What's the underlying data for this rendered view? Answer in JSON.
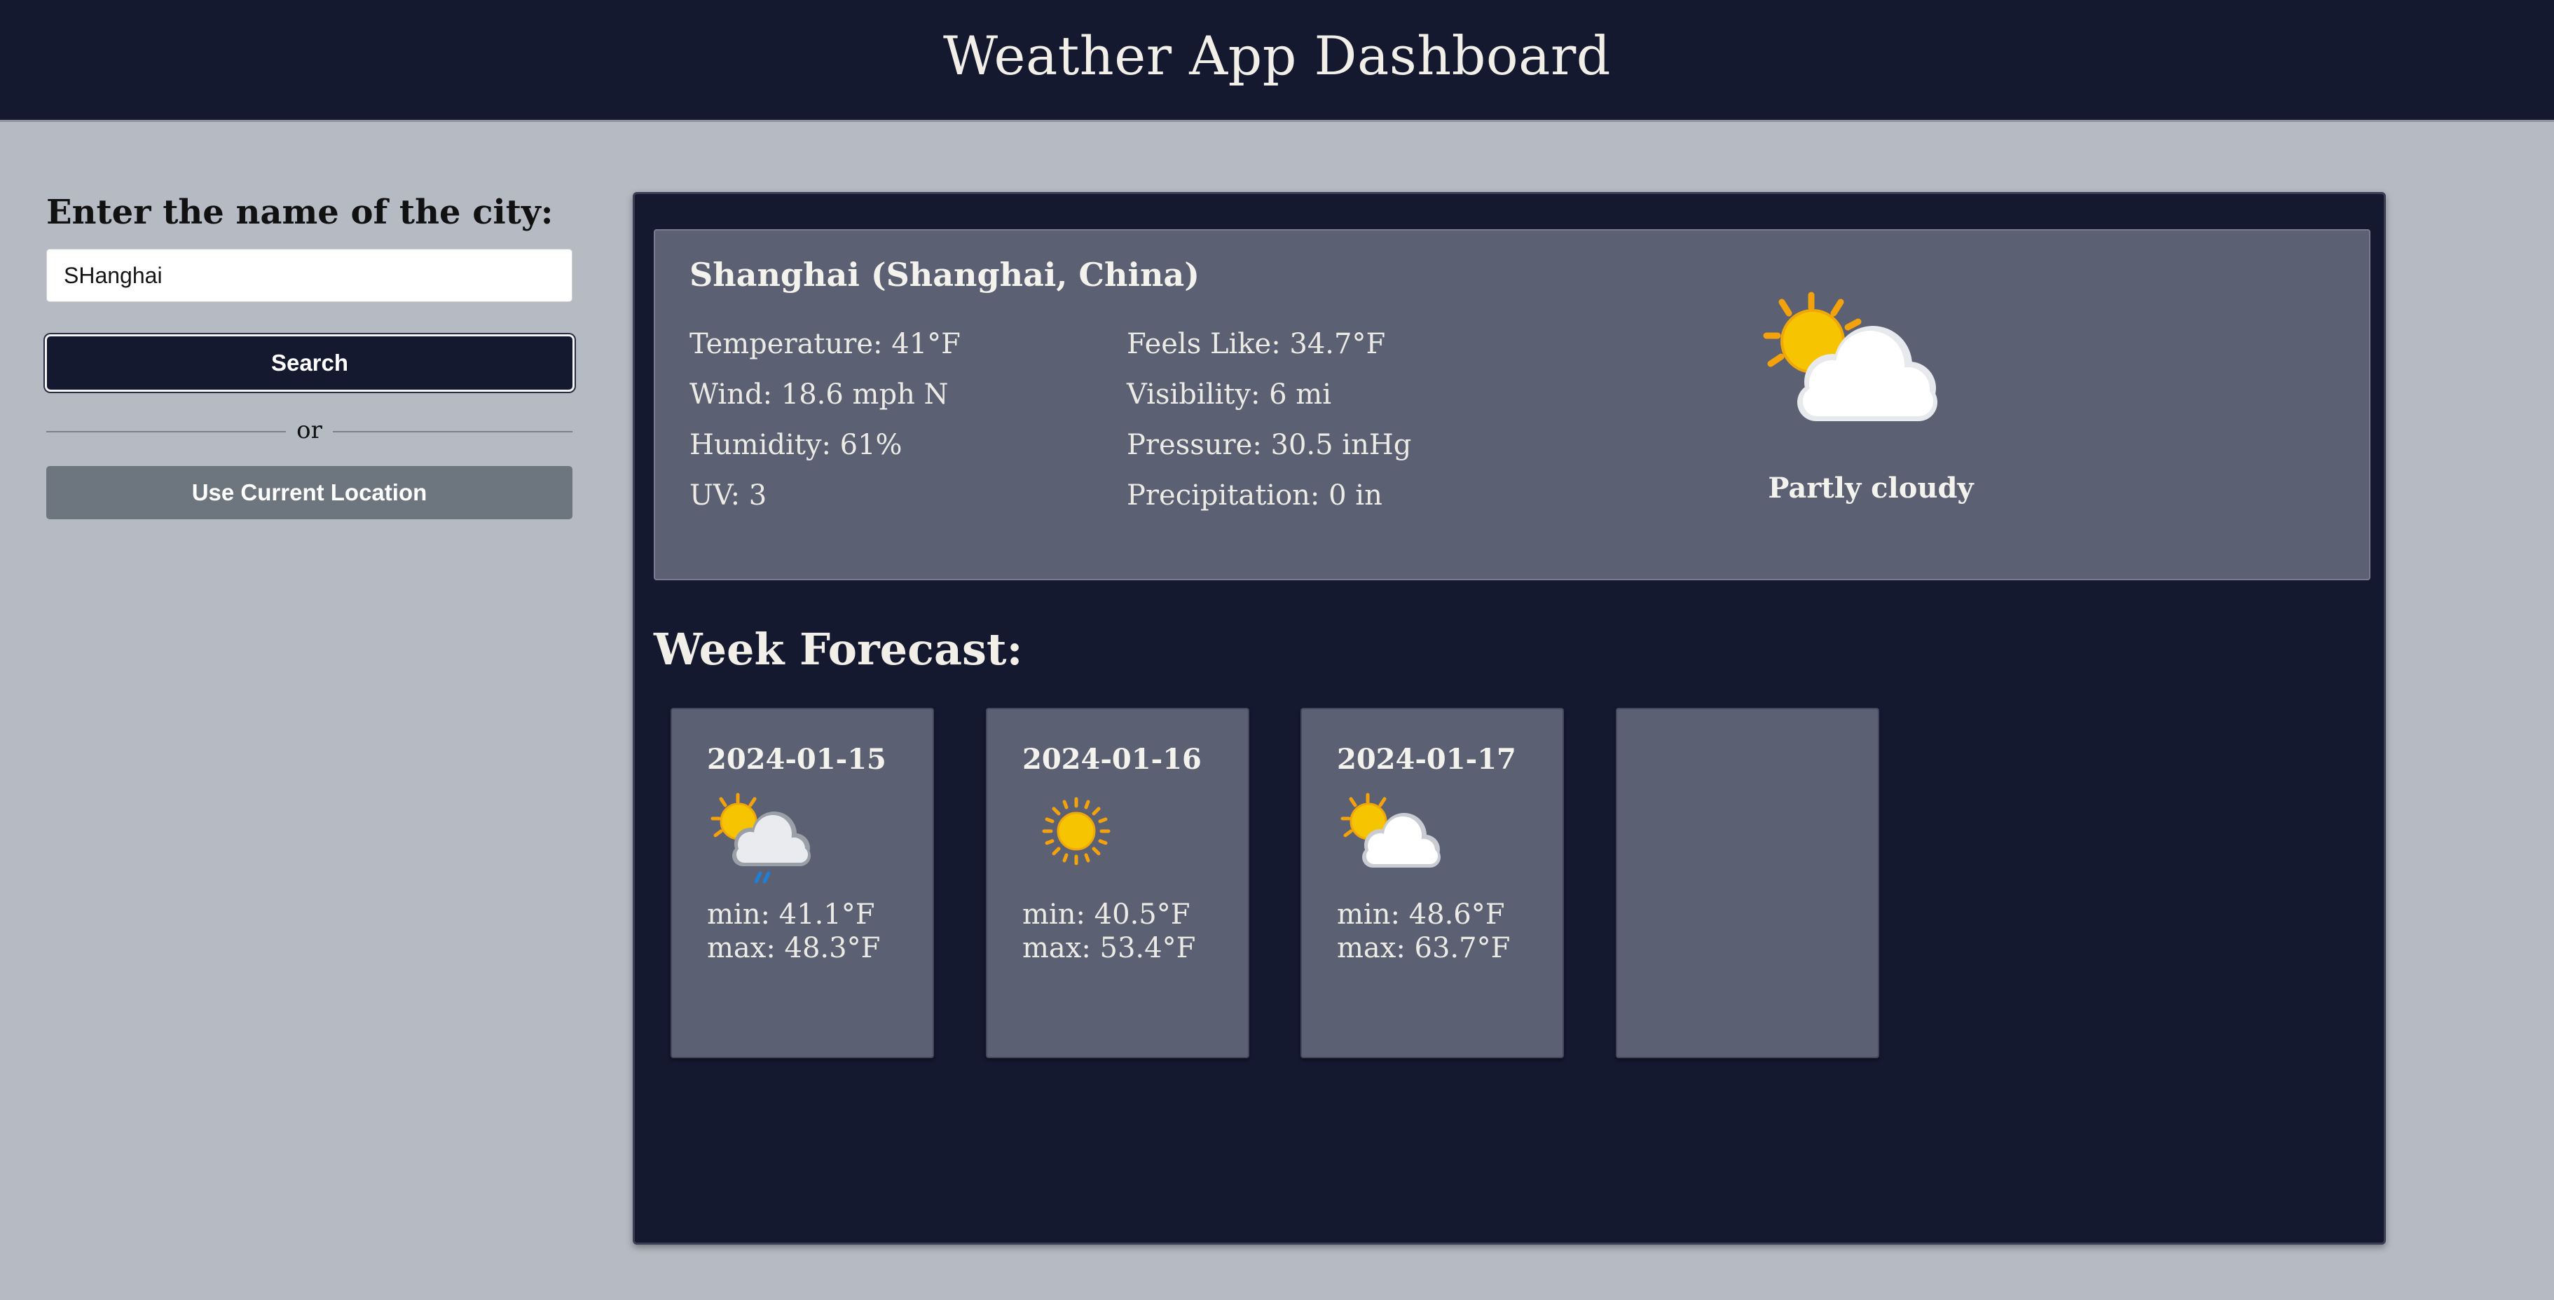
{
  "header": {
    "title": "Weather App Dashboard"
  },
  "sidebar": {
    "city_label": "Enter the name of the city:",
    "city_input_value": "SHanghai",
    "search_label": "Search",
    "or_text": "or",
    "current_location_label": "Use Current Location"
  },
  "current": {
    "location": "Shanghai (Shanghai, China)",
    "temperature": "Temperature: 41°F",
    "feels_like": "Feels Like: 34.7°F",
    "wind": "Wind: 18.6 mph N",
    "visibility": "Visibility: 6 mi",
    "humidity": "Humidity: 61%",
    "pressure": "Pressure: 30.5 inHg",
    "uv": "UV: 3",
    "precipitation": "Precipitation: 0 in",
    "condition": "Partly cloudy",
    "condition_icon": "partly-cloudy-icon"
  },
  "forecast": {
    "title": "Week Forecast:",
    "days": [
      {
        "date": "2024-01-15",
        "icon": "patchy-rain-icon",
        "min": "min: 41.1°F",
        "max": "max: 48.3°F"
      },
      {
        "date": "2024-01-16",
        "icon": "sunny-icon",
        "min": "min: 40.5°F",
        "max": "max: 53.4°F"
      },
      {
        "date": "2024-01-17",
        "icon": "partly-cloudy-icon",
        "min": "min: 48.6°F",
        "max": "max: 63.7°F"
      }
    ]
  },
  "colors": {
    "page_background": "#b6bac3",
    "header_background": "#151930",
    "panel_background": "#151930",
    "card_background": "#5c6073",
    "location_button": "#6d757e"
  }
}
